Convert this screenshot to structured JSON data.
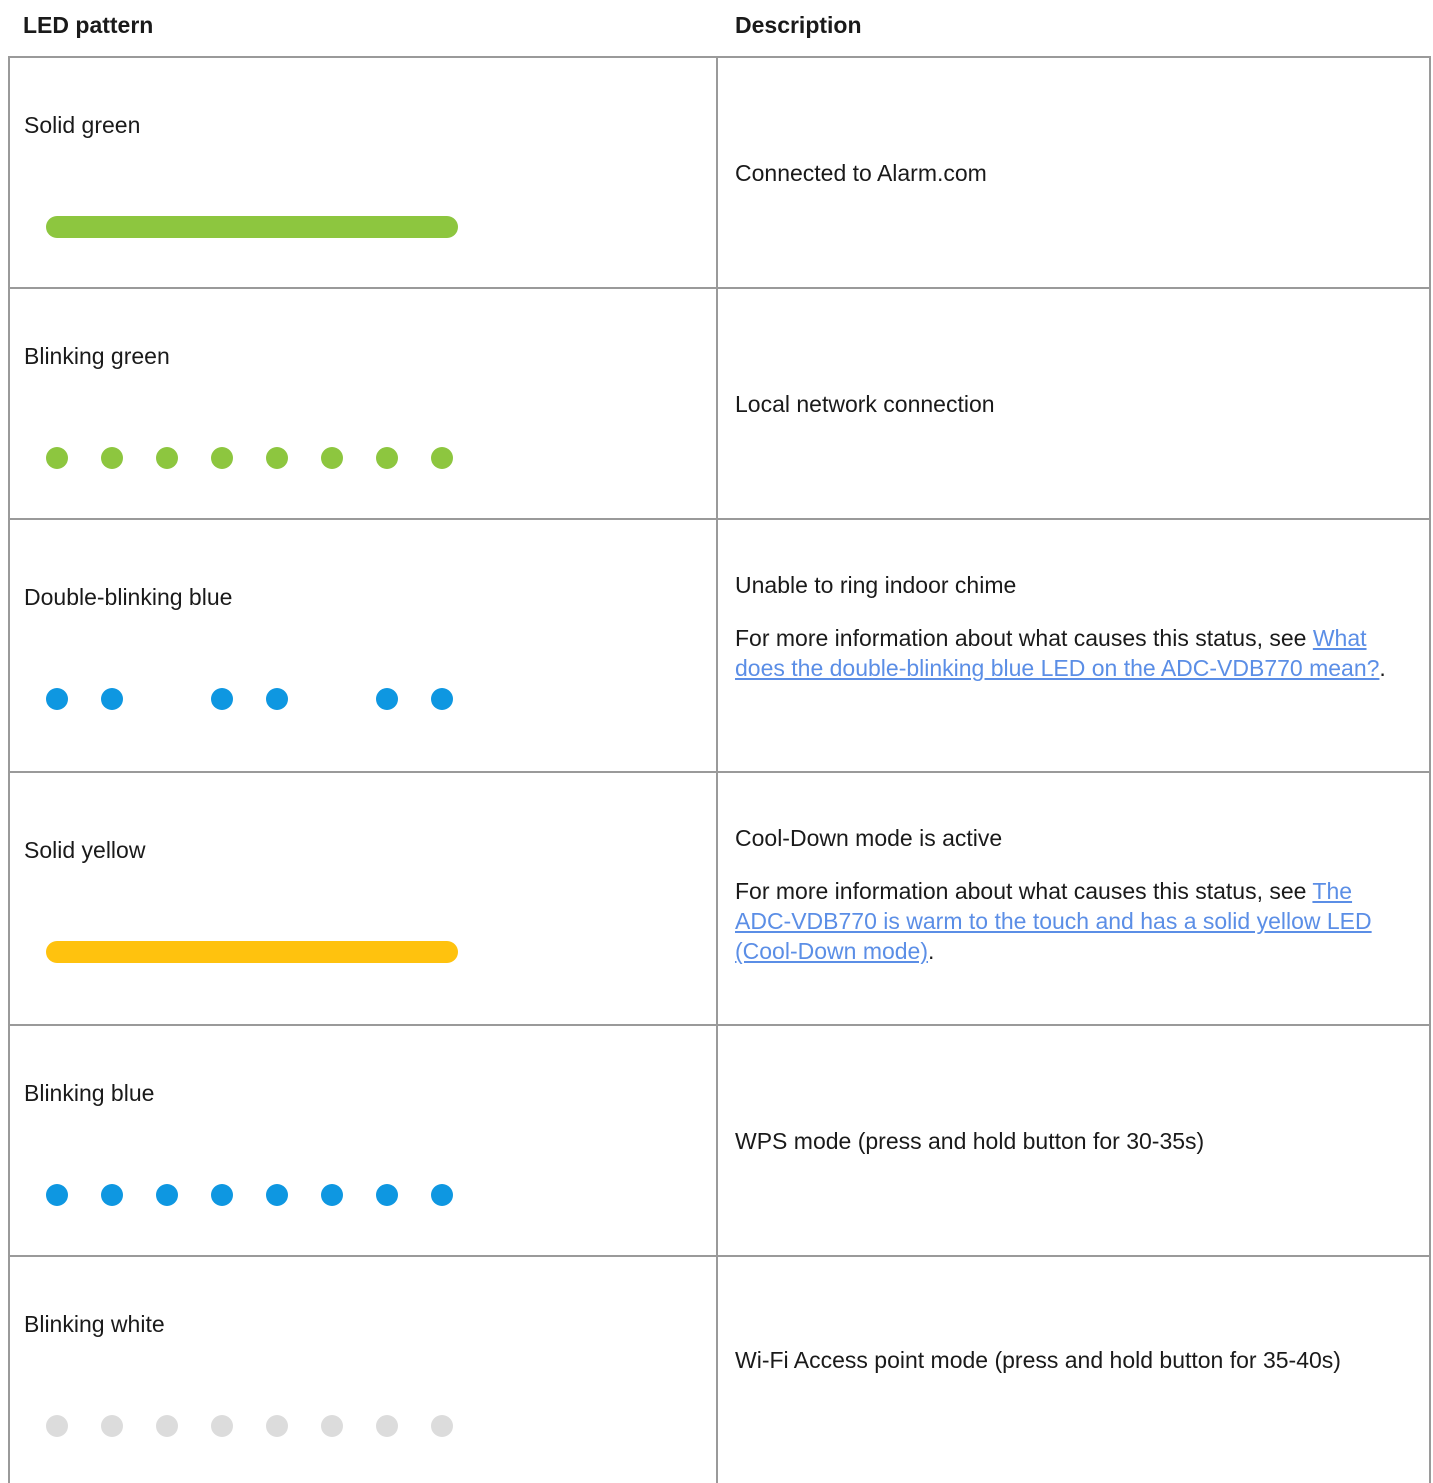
{
  "header": {
    "led_pattern": "LED pattern",
    "description": "Description"
  },
  "colors": {
    "green": "#8dc63f",
    "blue": "#0e97e1",
    "yellow": "#ffc20e",
    "white": "#dcdcdc",
    "link": "#5b8ee6",
    "border": "#9a9a9a"
  },
  "rows": [
    {
      "pattern": "Solid green",
      "kind": "solid",
      "color": "green",
      "desc": "Connected to Alarm.com"
    },
    {
      "pattern": "Blinking green",
      "kind": "blink",
      "color": "green",
      "desc": "Local network connection"
    },
    {
      "pattern": "Double-blinking blue",
      "kind": "double",
      "color": "blue",
      "desc": "Unable to ring indoor chime",
      "more_prefix": "For more information about what causes this status, see ",
      "link": "What does the double-blinking blue LED on the ADC-VDB770 mean?",
      "more_suffix": "."
    },
    {
      "pattern": "Solid yellow",
      "kind": "solid",
      "color": "yellow",
      "desc": "Cool-Down mode is active",
      "more_prefix": "For more information about what causes this status, see ",
      "link": "The ADC-VDB770 is warm to the touch and has a solid yellow LED (Cool-Down mode)",
      "more_suffix": "."
    },
    {
      "pattern": "Blinking blue",
      "kind": "blink",
      "color": "blue",
      "desc": "WPS mode (press and hold button for 30-35s)"
    },
    {
      "pattern": "Blinking white",
      "kind": "blink",
      "color": "white",
      "desc": "Wi-Fi Access point mode (press and hold button for 35-40s)"
    }
  ]
}
